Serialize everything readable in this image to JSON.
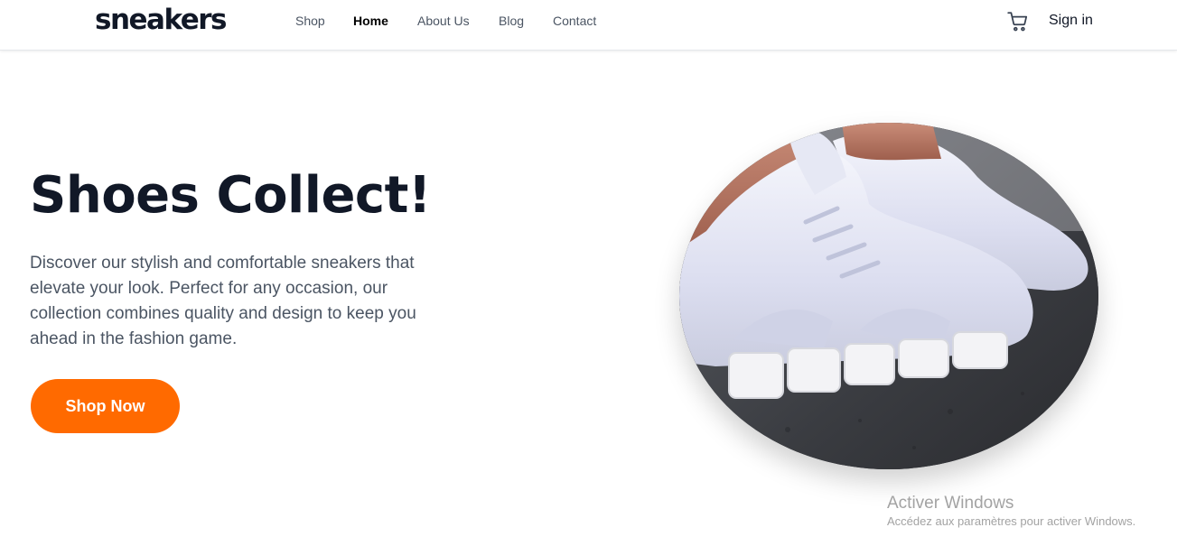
{
  "header": {
    "logo": "sneakers",
    "nav": [
      {
        "label": "Shop",
        "active": false
      },
      {
        "label": "Home",
        "active": true
      },
      {
        "label": "About Us",
        "active": false
      },
      {
        "label": "Blog",
        "active": false
      },
      {
        "label": "Contact",
        "active": false
      }
    ],
    "cart_icon": "cart-icon",
    "signin_label": "Sign in"
  },
  "hero": {
    "title": "Shoes Collect!",
    "description": "Discover our stylish and comfortable sneakers that elevate your look. Perfect for any occasion, our collection combines quality and design to keep you ahead in the fashion game.",
    "cta_label": "Shop Now",
    "image": "white-sneakers-photo"
  },
  "watermark": {
    "title": "Activer Windows",
    "subtitle": "Accédez aux paramètres pour activer Windows."
  },
  "colors": {
    "accent": "#ff6a00",
    "heading": "#111827",
    "body_text": "#4b5563",
    "nav_text": "#4b5563"
  }
}
